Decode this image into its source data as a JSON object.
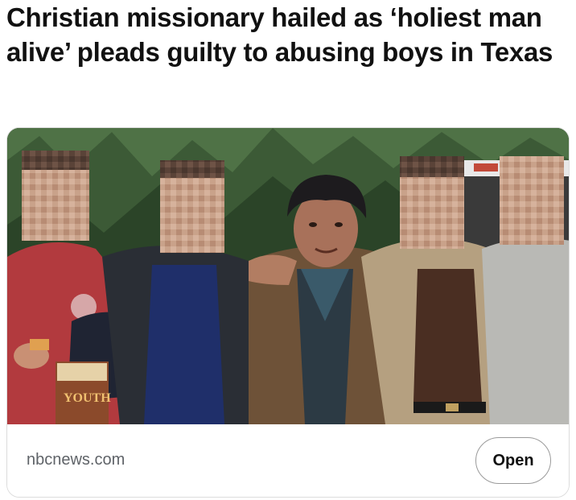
{
  "headline": "Christian missionary hailed as ‘holiest man alive’ pleads guilty to abusing boys in Texas",
  "link_card": {
    "source_domain": "nbcnews.com",
    "open_button_label": "Open",
    "book_cover_text": "YOUTH"
  },
  "colors": {
    "background": "#ffffff",
    "headline_text": "#111111",
    "domain_text": "#5f6368",
    "card_border": "#dcdcdc",
    "button_border": "#9a9a9a"
  }
}
